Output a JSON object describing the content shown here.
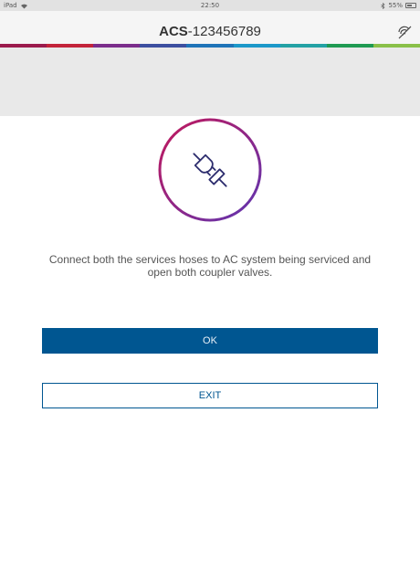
{
  "status_bar": {
    "device": "iPad",
    "time": "22:50",
    "battery": "55%"
  },
  "header": {
    "title_bold": "ACS",
    "title_rest": "-123456789",
    "sync_icon": "sync-off-icon"
  },
  "stripe_colors": [
    "#9b1b4c",
    "#c3243a",
    "#7b2d8b",
    "#3d4fa0",
    "#1f74b8",
    "#1c98c9",
    "#23a1a4",
    "#1f9a52",
    "#8ac049"
  ],
  "dialog": {
    "icon": "plug-connect-icon",
    "message": "Connect both the services hoses to AC system being serviced and open both coupler valves.",
    "ok_label": "OK",
    "exit_label": "EXIT"
  },
  "colors": {
    "primary": "#005691",
    "ring_start": "#c2185b",
    "ring_end": "#5e35b1"
  }
}
